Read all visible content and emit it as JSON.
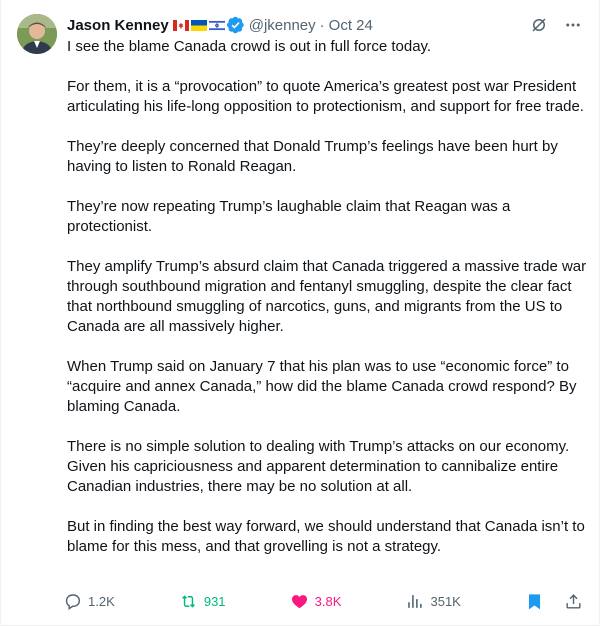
{
  "author": {
    "name": "Jason Kenney",
    "handle": "@jkenney",
    "separator": "·",
    "date": "Oct 24",
    "flags": [
      "canada-flag-icon",
      "ukraine-flag-icon",
      "israel-flag-icon"
    ],
    "verified_color": "#1d9bf0"
  },
  "paragraphs": [
    "I see the blame Canada crowd is out in full force today.",
    "For them, it is a “provocation” to quote America’s greatest post war President articulating his life-long opposition to protectionism, and support for free trade.",
    "They’re deeply concerned that Donald Trump’s feelings have been hurt by having to listen to Ronald Reagan.",
    "They’re now repeating Trump’s laughable claim that Reagan was a protectionist.",
    "They amplify Trump’s absurd claim that Canada triggered a massive trade war through southbound migration and fentanyl smuggling, despite the clear fact that northbound smuggling of narcotics, guns, and migrants from the US to Canada are all massively higher.",
    "When Trump said on January 7 that his plan was to use “economic force” to “acquire and annex Canada,” how did the blame Canada crowd respond? By blaming Canada.",
    "There is no simple solution to dealing with Trump’s attacks on our economy. Given his capriciousness and apparent determination to cannibalize entire Canadian industries, there may be no solution at all.",
    "But in finding the best way forward, we should understand that Canada isn’t to blame for this mess, and that grovelling is not a strategy."
  ],
  "metrics": {
    "replies": "1.2K",
    "retweets": "931",
    "likes": "3.8K",
    "views": "351K"
  },
  "colors": {
    "text": "#0f1419",
    "muted": "#536471",
    "retweet": "#00ba7c",
    "like": "#f91880",
    "bookmark": "#1d9bf0"
  }
}
